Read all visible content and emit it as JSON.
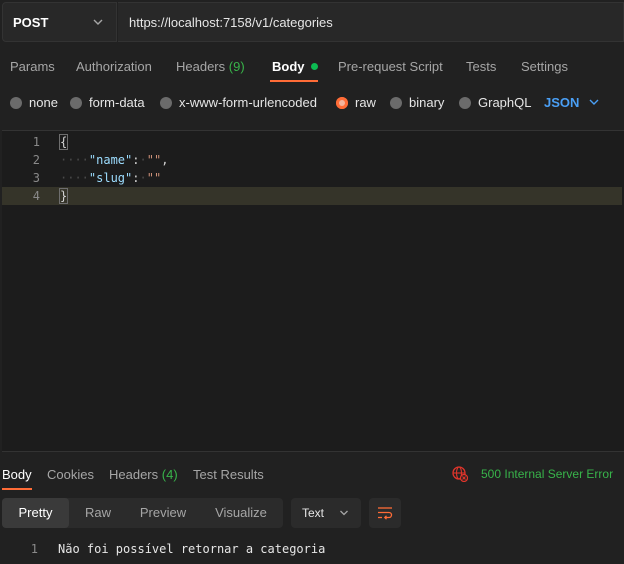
{
  "request": {
    "method": "POST",
    "url": "https://localhost:7158/v1/categories"
  },
  "request_tabs": {
    "params": "Params",
    "authorization": "Authorization",
    "headers": "Headers",
    "headers_count": "(9)",
    "body": "Body",
    "prerequest": "Pre-request Script",
    "tests": "Tests",
    "settings": "Settings"
  },
  "body_types": {
    "none": "none",
    "form_data": "form-data",
    "urlencoded": "x-www-form-urlencoded",
    "raw": "raw",
    "binary": "binary",
    "graphql": "GraphQL",
    "selected": "raw",
    "format": "JSON"
  },
  "editor": {
    "line_numbers": [
      "1",
      "2",
      "3",
      "4"
    ],
    "open_brace": "{",
    "close_brace": "}",
    "indent": "····",
    "key1": "\"name\"",
    "colon": ":",
    "spacer": "·",
    "val1": "\"\"",
    "comma": ",",
    "key2": "\"slug\"",
    "val2": "\"\""
  },
  "response": {
    "tabs": {
      "body": "Body",
      "cookies": "Cookies",
      "headers": "Headers",
      "headers_count": "(4)",
      "test_results": "Test Results"
    },
    "status": "500 Internal Server Error",
    "status_color": "#38b44a",
    "views": {
      "pretty": "Pretty",
      "raw": "Raw",
      "preview": "Preview",
      "visualize": "Visualize"
    },
    "format": "Text",
    "line_number": "1",
    "text": "Não foi possível retornar a categoria"
  },
  "colors": {
    "accent": "#ff6c37",
    "json_blue": "#4a9ff5",
    "body_dot": "#0cbb52"
  }
}
